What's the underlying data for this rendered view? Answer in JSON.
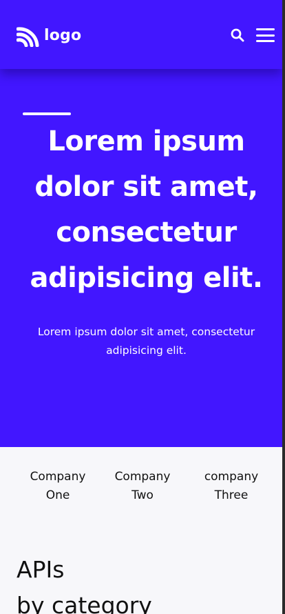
{
  "header": {
    "logo_text": "logo",
    "logo_icon": "rss-feed-icon",
    "search_icon": "search-icon",
    "menu_icon": "hamburger-menu-icon"
  },
  "hero": {
    "title": "Lorem ipsum dolor sit amet, consectetur adipisicing elit.",
    "subtitle": "Lorem ipsum dolor sit amet, consectetur adipisicing elit."
  },
  "companies": [
    {
      "line1": "Company",
      "line2": "One"
    },
    {
      "line1": "Company",
      "line2": "Two"
    },
    {
      "line1": "company",
      "line2": "Three"
    }
  ],
  "apis_section": {
    "title_line1": "APIs",
    "title_line2": "by category"
  },
  "colors": {
    "primary": "#4216ff",
    "background": "#f7f7fa",
    "text_light": "#ffffff",
    "text_dark": "#111111"
  }
}
